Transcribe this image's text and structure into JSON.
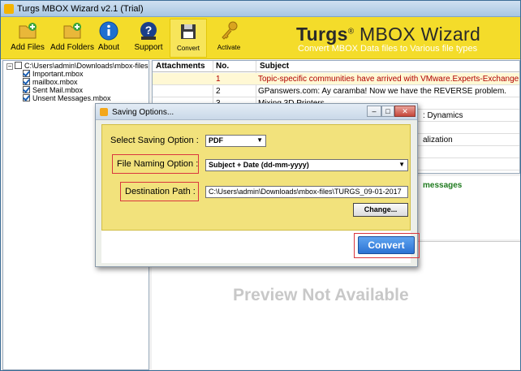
{
  "window": {
    "title": "Turgs MBOX Wizard v2.1 (Trial)"
  },
  "toolbar": {
    "buttons": [
      {
        "label": "Add Files",
        "icon": "add-files-icon"
      },
      {
        "label": "Add Folders",
        "icon": "add-folders-icon"
      },
      {
        "label": "About",
        "icon": "info-icon"
      },
      {
        "label": "Support",
        "icon": "support-icon"
      },
      {
        "label": "Convert",
        "icon": "floppy-icon"
      },
      {
        "label": "Activate",
        "icon": "key-icon"
      }
    ],
    "brand_bold": "Turgs",
    "brand_reg": "®",
    "brand_rest": " MBOX Wizard",
    "tagline": "Convert MBOX Data files to Various file types"
  },
  "tree": {
    "root": "C:\\Users\\admin\\Downloads\\mbox-files",
    "items": [
      "Important.mbox",
      "mailbox.mbox",
      "Sent Mail.mbox",
      "Unsent Messages.mbox"
    ]
  },
  "grid": {
    "headers": [
      "Attachments",
      "No.",
      "Subject"
    ],
    "rows": [
      {
        "no": "1",
        "subject": "Topic-specific communities have arrived with VMware.Experts-Exchange.c"
      },
      {
        "no": "2",
        "subject": "GPanswers.com: Ay caramba! Now we have the REVERSE problem."
      },
      {
        "no": "3",
        "subject": "Mixing 3D Printers"
      },
      {
        "no": "",
        "subject": ": Dynamics"
      },
      {
        "no": "",
        "subject": ""
      },
      {
        "no": "",
        "subject": "alization"
      },
      {
        "no": "",
        "subject": ""
      }
    ]
  },
  "messages_label": "messages",
  "preview_text": "Preview Not Available",
  "dialog": {
    "title": "Saving Options...",
    "select_saving_label": "Select Saving Option :",
    "saving_value": "PDF",
    "file_naming_label": "File Naming Option :",
    "file_naming_value": "Subject + Date (dd-mm-yyyy)",
    "destination_label": "Destination Path :",
    "destination_value": "C:\\Users\\admin\\Downloads\\mbox-files\\TURGS_09-01-2017",
    "change_button": "Change...",
    "convert_button": "Convert"
  },
  "colors": {
    "toolbar_yellow": "#f4dc2a",
    "dialog_body": "#f2e27c",
    "convert_blue": "#2c72d3",
    "highlight_red": "#d9363e",
    "message_green": "#1e7a1e"
  }
}
